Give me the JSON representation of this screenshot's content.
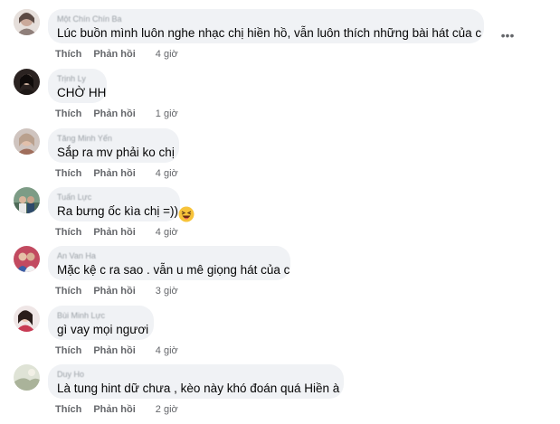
{
  "comments": [
    {
      "author": "Một Chín Chín Ba",
      "text": "Lúc buồn mình luôn nghe nhạc chị hiền hồ, vẫn luôn thích những bài hát của c",
      "like": "Thích",
      "reply": "Phản hồi",
      "time": "4 giờ",
      "avatar_color": "#d9cfcb",
      "avatar_icon": "avatar-photo-woman"
    },
    {
      "author": "Trịnh Ly",
      "text": "CHỜ HH",
      "like": "Thích",
      "reply": "Phản hồi",
      "time": "1 giờ",
      "avatar_color": "#3a2f2c",
      "avatar_icon": "avatar-photo-woman"
    },
    {
      "author": "Tăng Minh Yến",
      "text": "Sắp ra mv phải ko chị",
      "like": "Thích",
      "reply": "Phản hồi",
      "time": "4 giờ",
      "avatar_color": "#c7a48f",
      "avatar_icon": "avatar-photo-woman"
    },
    {
      "author": "Tuấn Lực",
      "text": "Ra bưng ốc kìa chị =))",
      "like": "Thích",
      "reply": "Phản hồi",
      "time": "4 giờ",
      "avatar_color": "#6a8a73",
      "avatar_icon": "avatar-photo-group",
      "emoji": "laughing-emoji"
    },
    {
      "author": "An Van Ha",
      "text": "Mặc kệ c ra sao . vẫn u mê giọng hát của c",
      "like": "Thích",
      "reply": "Phản hồi",
      "time": "3 giờ",
      "avatar_color": "#b0455a",
      "avatar_icon": "avatar-photo-couple"
    },
    {
      "author": "Bùi Minh Lực",
      "text": "gì vay mọi ngươi",
      "like": "Thích",
      "reply": "Phản hồi",
      "time": "4 giờ",
      "avatar_color": "#e7d7d7",
      "avatar_icon": "avatar-photo-woman"
    },
    {
      "author": "Duy Ho",
      "text": "Là tung hint dữ chưa , kèo này khó đoán quá Hiền à",
      "like": "Thích",
      "reply": "Phản hồi",
      "time": "2 giờ",
      "avatar_color": "#cfd3c4",
      "avatar_icon": "avatar-photo-landscape"
    }
  ],
  "more_icon": "more-options-icon"
}
